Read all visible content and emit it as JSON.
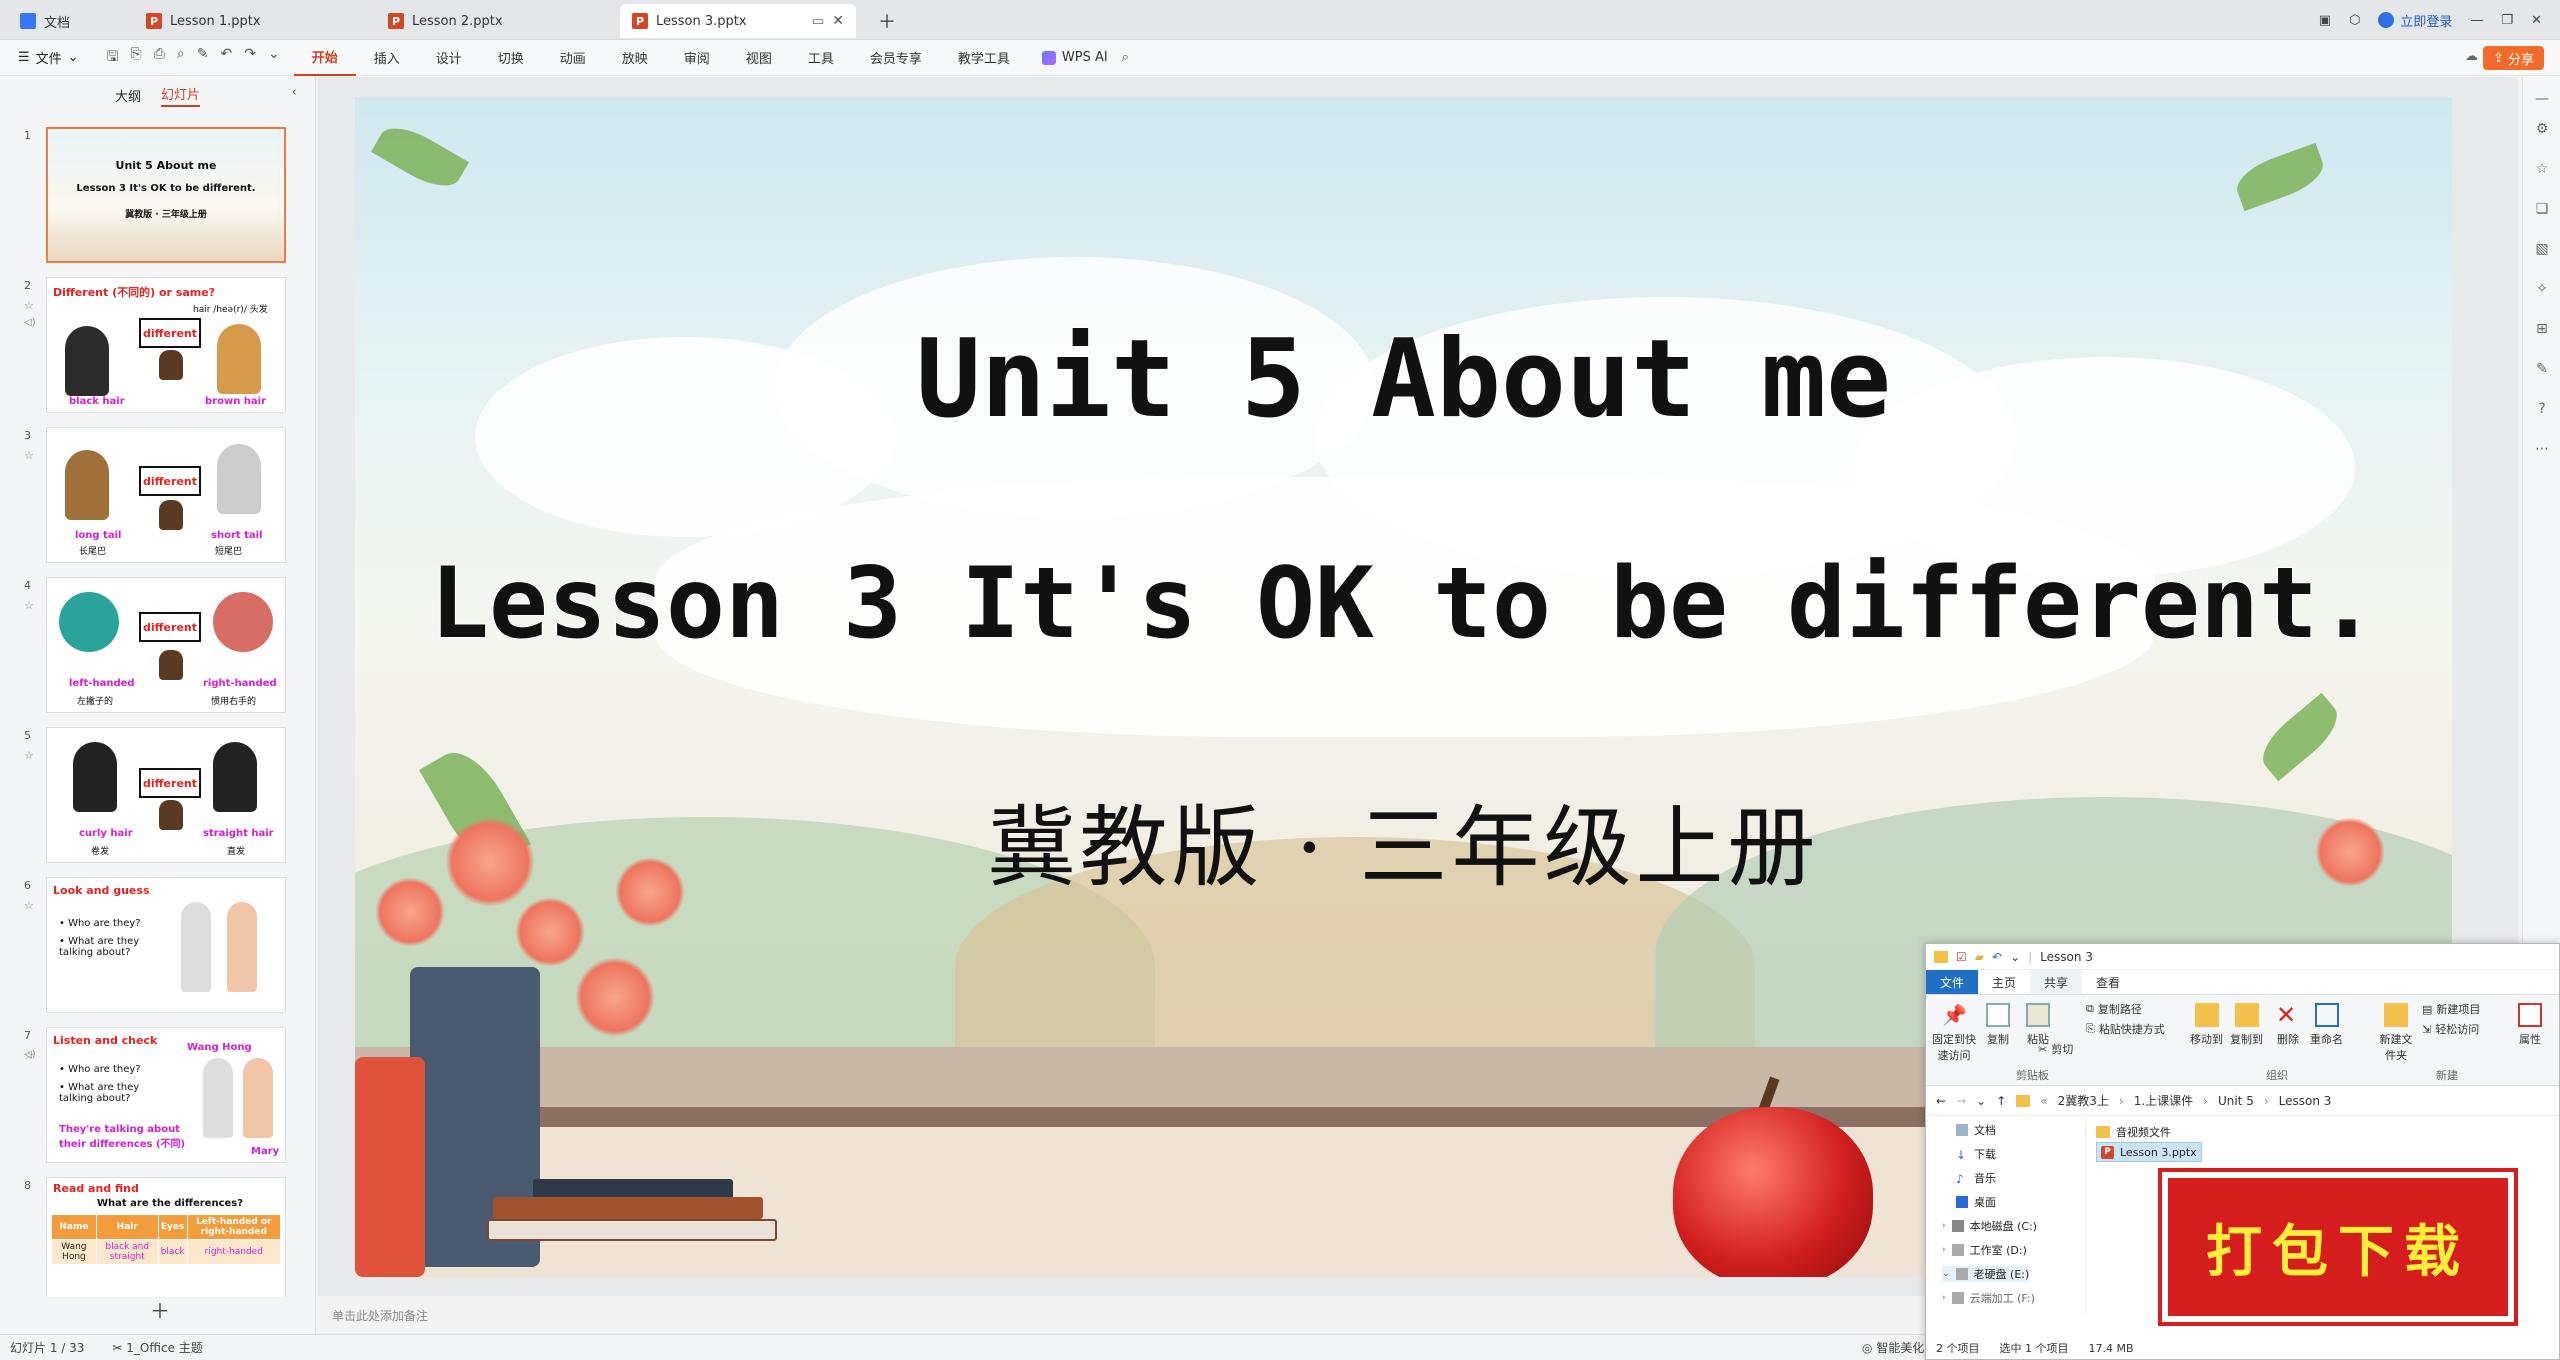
{
  "tabs": [
    {
      "label": "文档",
      "type": "doc"
    },
    {
      "label": "Lesson 1.pptx",
      "type": "ppt"
    },
    {
      "label": "Lesson 2.pptx",
      "type": "ppt"
    },
    {
      "label": "Lesson 3.pptx",
      "type": "ppt",
      "active": true
    }
  ],
  "header": {
    "login": "立即登录",
    "share": "分享"
  },
  "ribbon": {
    "file": "文件",
    "tabs": [
      "开始",
      "插入",
      "设计",
      "切换",
      "动画",
      "放映",
      "审阅",
      "视图",
      "工具",
      "会员专享",
      "教学工具"
    ],
    "ai": "WPS AI"
  },
  "left_panel": {
    "outline": "大纲",
    "slides": "幻灯片"
  },
  "thumbs": [
    {
      "num": "1",
      "l1": "Unit 5 About me",
      "l2": "Lesson 3 It's OK to be different.",
      "l3": "冀教版 · 三年级上册"
    },
    {
      "num": "2",
      "title": "Different (不同的) or same?",
      "phon": "hair /heə(r)/ 头发",
      "sign": "different",
      "a": "black hair",
      "b": "brown hair"
    },
    {
      "num": "3",
      "sign": "different",
      "a": "long tail",
      "a2": "长尾巴",
      "b": "short tail",
      "b2": "短尾巴"
    },
    {
      "num": "4",
      "sign": "different",
      "a": "left-handed",
      "a2": "左撇子的",
      "b": "right-handed",
      "b2": "惯用右手的"
    },
    {
      "num": "5",
      "sign": "different",
      "a": "curly hair",
      "a2": "卷发",
      "b": "straight hair",
      "b2": "直发"
    },
    {
      "num": "6",
      "title": "Look and guess",
      "q1": "Who are they?",
      "q2": "What are they talking about?"
    },
    {
      "num": "7",
      "title": "Listen and check",
      "q1": "Who are they?",
      "q2": "What are they talking about?",
      "n1": "Wang Hong",
      "n2": "Mary",
      "ans": "They're talking about their differences (不同)"
    },
    {
      "num": "8",
      "title": "Read and find",
      "sub": "What are the differences?",
      "cols": [
        "Name",
        "Hair",
        "Eyes",
        "Left-handed or right-handed"
      ],
      "row": [
        "Wang Hong",
        "black and straight",
        "black",
        "right-handed"
      ]
    }
  ],
  "slide": {
    "title1": "Unit 5 About me",
    "title2": "Lesson 3 It's OK to be different.",
    "subtitle": "冀教版 · 三年级上册"
  },
  "notes_placeholder": "单击此处添加备注",
  "status": {
    "slide_info": "幻灯片 1 / 33",
    "theme": "1_Office 主题",
    "beautify": "智能美化"
  },
  "explorer": {
    "title": "Lesson 3",
    "tabs": [
      "文件",
      "主页",
      "共享",
      "查看"
    ],
    "buttons": {
      "pin": "固定到快速访问",
      "copy": "复制",
      "paste": "粘贴",
      "copy_path": "复制路径",
      "paste_shortcut": "粘贴快捷方式",
      "cut": "剪切",
      "move_to": "移动到",
      "copy_to": "复制到",
      "delete": "删除",
      "rename": "重命名",
      "new_folder": "新建文件夹",
      "new_item": "新建项目",
      "easy_access": "轻松访问",
      "properties": "属性"
    },
    "groups": {
      "clipboard": "剪贴板",
      "organize": "组织",
      "new": "新建"
    },
    "breadcrumb": [
      "2冀教3上",
      "1.上课课件",
      "Unit 5",
      "Lesson 3"
    ],
    "tree": [
      "文档",
      "下载",
      "音乐",
      "桌面",
      "本地磁盘 (C:)",
      "工作室 (D:)",
      "老硬盘 (E:)",
      "云端加工 (F:)"
    ],
    "files": [
      {
        "name": "音视频文件",
        "kind": "folder"
      },
      {
        "name": "Lesson 3.pptx",
        "kind": "ppt"
      }
    ],
    "status_items": "2 个项目",
    "status_sel": "选中 1 个项目",
    "status_size": "17.4 MB"
  },
  "download_badge": "打包下载"
}
